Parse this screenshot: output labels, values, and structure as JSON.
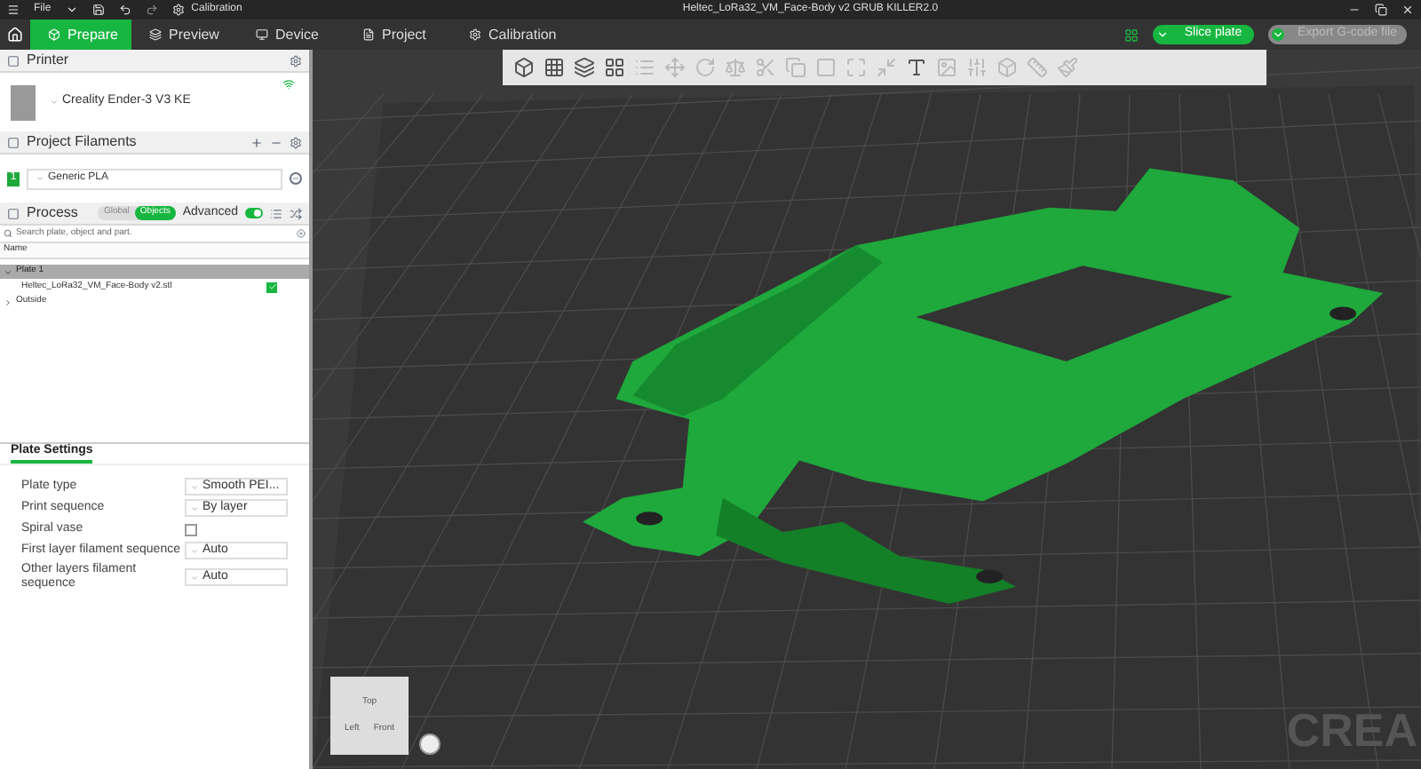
{
  "title_bar": {
    "menu": "File",
    "quick_action": "Calibration",
    "title": "Heltec_LoRa32_VM_Face-Body v2 GRUB KILLER2.0"
  },
  "tabs": [
    {
      "label": "Prepare",
      "selected": true
    },
    {
      "label": "Preview",
      "selected": false
    },
    {
      "label": "Device",
      "selected": false
    },
    {
      "label": "Project",
      "selected": false
    },
    {
      "label": "Calibration",
      "selected": false
    }
  ],
  "actions": [
    {
      "label": "Slice plate",
      "disabled": false
    },
    {
      "label": "Export G-code file",
      "disabled": true
    }
  ],
  "printer": {
    "title": "Printer",
    "name": "Creality Ender-3 V3 KE"
  },
  "filaments": {
    "title": "Project Filaments",
    "items": [
      {
        "index": "1",
        "name": "Generic PLA",
        "color": "#1fa83c"
      }
    ]
  },
  "process": {
    "title": "Process",
    "modes": [
      {
        "label": "Global",
        "selected": false
      },
      {
        "label": "Objects",
        "selected": true
      }
    ],
    "advanced_label": "Advanced",
    "advanced_on": true,
    "search_placeholder": "Search plate, object and part.",
    "column": "Name",
    "tree": [
      {
        "label": "Plate 1",
        "expanded": true,
        "children": [
          {
            "label": "Heltec_LoRa32_VM_Face-Body v2.stl",
            "checked": true
          }
        ]
      },
      {
        "label": "Outside",
        "expanded": false
      }
    ]
  },
  "plate_settings": {
    "tab": "Plate Settings",
    "rows": [
      {
        "kind": "select",
        "label": "Plate type",
        "value": "Smooth PEI..."
      },
      {
        "kind": "select",
        "label": "Print sequence",
        "value": "By layer"
      },
      {
        "kind": "checkbox",
        "label": "Spiral vase",
        "checked": false
      },
      {
        "kind": "select",
        "label": "First layer filament sequence",
        "value": "Auto"
      },
      {
        "kind": "select",
        "label": "Other layers filament sequence",
        "value": "Auto"
      }
    ]
  },
  "viewport": {
    "cube_faces": [
      "Top",
      "Left",
      "Front"
    ],
    "bed_logo": "CREA"
  }
}
